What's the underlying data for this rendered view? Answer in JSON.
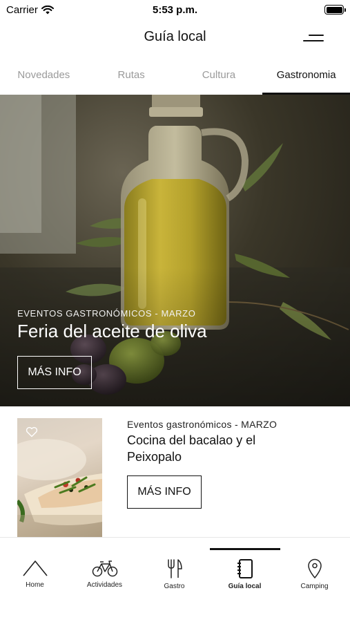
{
  "status_bar": {
    "carrier": "Carrier",
    "time": "5:53 p.m."
  },
  "nav": {
    "title": "Guía local",
    "menu_icon": "menu-icon"
  },
  "tabs": [
    {
      "label": "Novedades",
      "active": false
    },
    {
      "label": "Rutas",
      "active": false
    },
    {
      "label": "Cultura",
      "active": false
    },
    {
      "label": "Gastronomia",
      "active": true
    }
  ],
  "hero": {
    "subtitle": "EVENTOS GASTRONÓMICOS - MARZO",
    "title": "Feria del aceite de oliva",
    "button_label": "MÁS INFO"
  },
  "card": {
    "subtitle": "Eventos gastronómicos - MARZO",
    "title": "Cocina del bacalao y el Peixopalo",
    "button_label": "MÁS INFO",
    "favorite_icon": "heart-icon"
  },
  "tab_bar": {
    "items": [
      {
        "label": "Home",
        "icon": "home-icon",
        "active": false
      },
      {
        "label": "Actividades",
        "icon": "bicycle-icon",
        "active": false
      },
      {
        "label": "Gastro",
        "icon": "cutlery-icon",
        "active": false
      },
      {
        "label": "Guía local",
        "icon": "notebook-icon",
        "active": true
      },
      {
        "label": "Camping",
        "icon": "location-pin-icon",
        "active": false
      }
    ]
  },
  "colors": {
    "text": "#111111",
    "tab_inactive": "#9a9a9a",
    "background": "#ffffff"
  }
}
